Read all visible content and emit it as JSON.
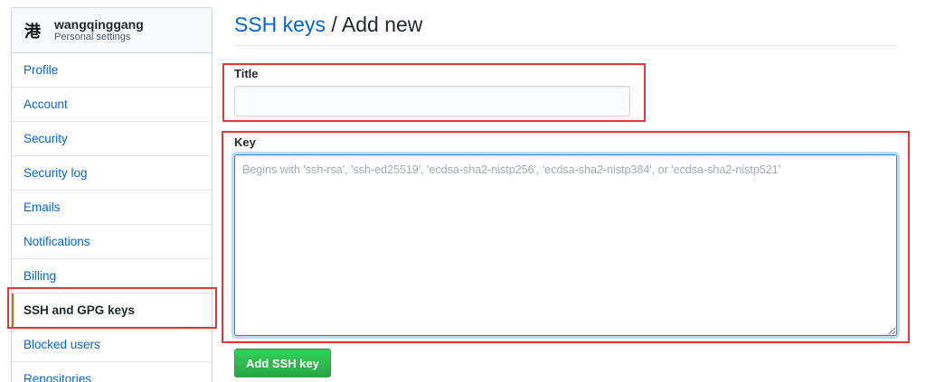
{
  "user": {
    "avatar_glyph": "港",
    "name": "wangqinggang",
    "subtitle": "Personal settings"
  },
  "sidebar": {
    "items": [
      {
        "label": "Profile",
        "selected": false
      },
      {
        "label": "Account",
        "selected": false
      },
      {
        "label": "Security",
        "selected": false
      },
      {
        "label": "Security log",
        "selected": false
      },
      {
        "label": "Emails",
        "selected": false
      },
      {
        "label": "Notifications",
        "selected": false
      },
      {
        "label": "Billing",
        "selected": false
      },
      {
        "label": "SSH and GPG keys",
        "selected": true
      },
      {
        "label": "Blocked users",
        "selected": false
      },
      {
        "label": "Repositories",
        "selected": false
      }
    ]
  },
  "heading": {
    "link": "SSH keys",
    "rest": " / Add new"
  },
  "form": {
    "title_label": "Title",
    "title_value": "",
    "key_label": "Key",
    "key_value": "",
    "key_placeholder": "Begins with 'ssh-rsa', 'ssh-ed25519', 'ecdsa-sha2-nistp256', 'ecdsa-sha2-nistp384', or 'ecdsa-sha2-nistp521'",
    "submit_label": "Add SSH key"
  },
  "colors": {
    "link": "#0366d6",
    "button": "#28a745",
    "annotation": "#e8363d",
    "selected_marker": "#e36209"
  }
}
